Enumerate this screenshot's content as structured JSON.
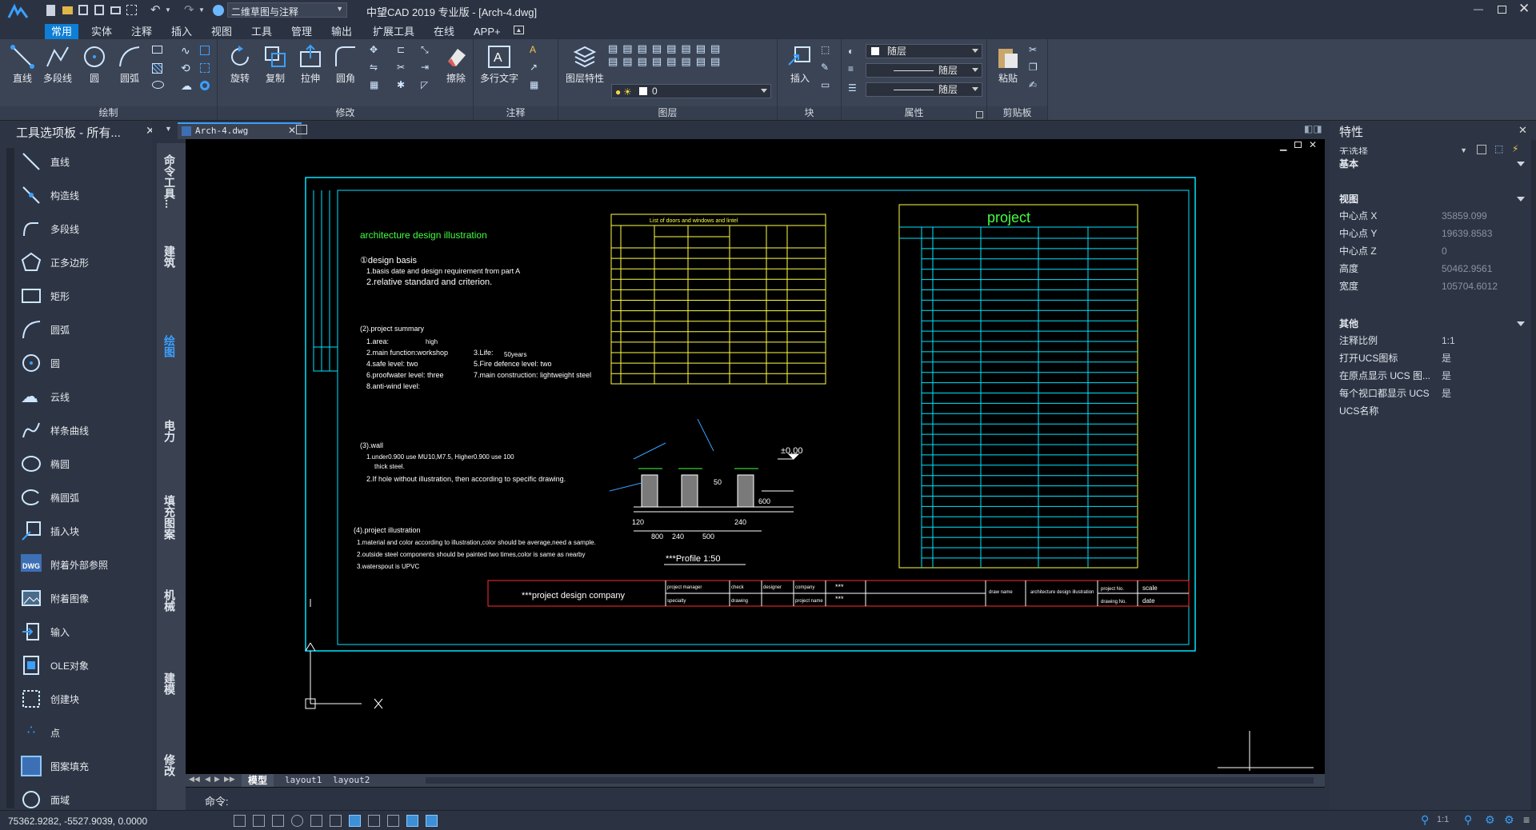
{
  "titlebar": {
    "title": "中望CAD 2019 专业版 - [Arch-4.dwg]",
    "workspace": "二维草图与注释"
  },
  "ribbon_tabs": [
    "常用",
    "实体",
    "注释",
    "插入",
    "视图",
    "工具",
    "管理",
    "输出",
    "扩展工具",
    "在线",
    "APP+"
  ],
  "draw_panel": {
    "label": "绘制",
    "line": "直线",
    "polyline": "多段线",
    "circle": "圆",
    "arc": "圆弧"
  },
  "modify_panel": {
    "label": "修改",
    "rotate": "旋转",
    "copy": "复制",
    "stretch": "拉伸",
    "fillet": "圆角",
    "erase": "擦除"
  },
  "annot_panel": {
    "label": "注释",
    "mtext": "多行文字"
  },
  "layer_panel": {
    "label": "图层",
    "layer_prop": "图层特性",
    "current_layer": "0"
  },
  "block_panel": {
    "label": "块",
    "insert": "插入"
  },
  "props_panel": {
    "label": "属性",
    "color": "随层",
    "linetype": "随层",
    "lineweight": "随层"
  },
  "clip_panel": {
    "label": "剪贴板",
    "paste": "粘贴"
  },
  "left_panel": {
    "title": "工具选项板 - 所有...",
    "tools": [
      "直线",
      "构造线",
      "多段线",
      "正多边形",
      "矩形",
      "圆弧",
      "圆",
      "云线",
      "样条曲线",
      "椭圆",
      "椭圆弧",
      "插入块",
      "附着外部参照",
      "附着图像",
      "输入",
      "OLE对象",
      "创建块",
      "点",
      "图案填充",
      "面域"
    ],
    "vtabs": [
      "命令工具...",
      "建筑",
      "绘图",
      "电力",
      "填充图案",
      "机械",
      "建模",
      "修改"
    ]
  },
  "doc_tab": "Arch-4.dwg",
  "layout_tabs": [
    "模型",
    "layout1",
    "layout2"
  ],
  "command": {
    "prompt": "命令:"
  },
  "right_panel": {
    "title": "特性",
    "selection": "无选择",
    "sections": {
      "basic": "基本",
      "view": "视图",
      "other": "其他"
    },
    "view_props": [
      {
        "k": "中心点 X",
        "v": "35859.099"
      },
      {
        "k": "中心点 Y",
        "v": "19639.8583"
      },
      {
        "k": "中心点 Z",
        "v": "0"
      },
      {
        "k": "高度",
        "v": "50462.9561"
      },
      {
        "k": "宽度",
        "v": "105704.6012"
      }
    ],
    "other_props": [
      {
        "k": "注释比例",
        "v": "1:1"
      },
      {
        "k": "打开UCS图标",
        "v": "是"
      },
      {
        "k": "在原点显示 UCS 图...",
        "v": "是"
      },
      {
        "k": "每个视口都显示 UCS",
        "v": "是"
      },
      {
        "k": "UCS名称",
        "v": ""
      }
    ]
  },
  "statusbar": {
    "coords": "75362.9282, -5527.9039, 0.0000",
    "scale": "1:1"
  },
  "drawing": {
    "title": "architecture design illustration",
    "notes": [
      "①design basis",
      "1.basis date and design requirement from part A",
      "2.relative standard and criterion.",
      "(2).project summary",
      "1.area:",
      "2.main function:workshop",
      "3.Life:",
      "4.safe level: two",
      "5.Fire defence level: two",
      "6.proofwater level: three",
      "7.main construction: lightweight steel",
      "8.anti-wind level:",
      "(3).wall",
      "1.under0.900 use MU10,M7.5, Higher0.900 use 100",
      "thick steel.",
      "2.If hole without illustration, then according to specific drawing.",
      "(4).project illustration",
      "1.material and color according to illustration,color should be average,need a sample.",
      "2.outside steel components should be painted two times,color is same as nearby",
      "3.waterspout is UPVC"
    ],
    "life_value": "50years",
    "high": "high",
    "table1_title": "List of doors and windows and lintel",
    "project_title": "project",
    "profile_label": "***Profile 1:50",
    "elev": "±0.00",
    "dims": [
      "120",
      "800",
      "240",
      "500",
      "240",
      "50",
      "600"
    ],
    "company": "***project design company",
    "company_marks": [
      "***",
      "***"
    ],
    "tb_labels": [
      "project manager",
      "check",
      "designer",
      "company",
      "specialty",
      "drawing",
      "project name",
      "draw name",
      "architecture design illustration",
      "project No.",
      "drawing No.",
      "scale",
      "date"
    ]
  }
}
